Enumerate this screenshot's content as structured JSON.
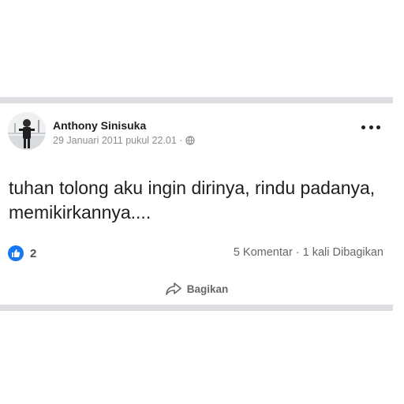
{
  "post": {
    "author": "Anthony Sinisuka",
    "date": "29 Januari 2011 pukul 22.01 ·",
    "privacy_icon": "globe-icon",
    "text": "tuhan tolong aku ingin dirinya, rindu padanya, memikirkannya....",
    "reactions": {
      "icon": "like-icon",
      "count": "2"
    },
    "comments": "5 Komentar",
    "separator": "·",
    "shares": "1 kali Dibagikan",
    "share_button": "Bagikan"
  },
  "colors": {
    "brand": "#1877f2",
    "separator": "#dcdee2",
    "secondary_text": "#65676b"
  }
}
